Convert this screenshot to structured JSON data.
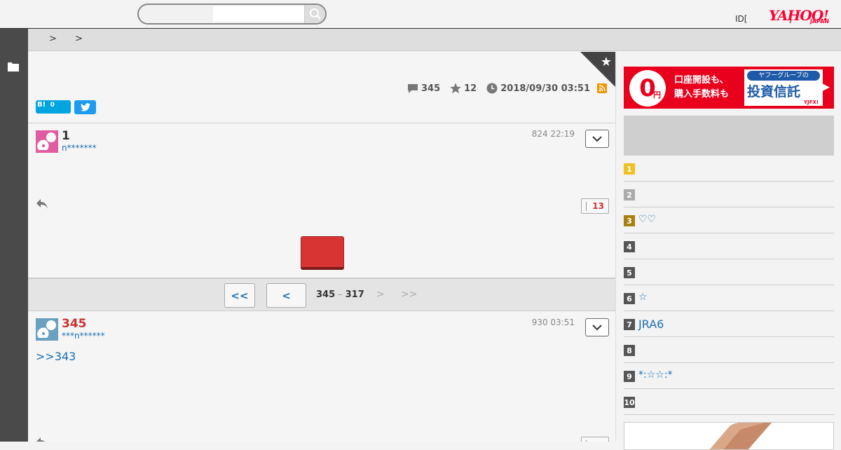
{
  "header": {
    "search_value": "",
    "id_link": "ID[",
    "id_bracket": "]",
    "logo_main": "YAHOO!",
    "logo_sub": "JAPAN"
  },
  "breadcrumb": {
    "sep1": ">",
    "sep2": ">"
  },
  "thread": {
    "comment_count": "345",
    "favorite_count": "12",
    "updated": "2018/09/30 03:51",
    "hatena_label": "B!",
    "hatena_count": "0"
  },
  "comments": [
    {
      "number": "1",
      "user": "n*******",
      "date": "824 22:19",
      "likes": "13"
    },
    {
      "number": "345",
      "user": "***n******",
      "date": "930 03:51",
      "body": ">>343"
    }
  ],
  "pager": {
    "first": "<<",
    "prev": "<",
    "range_start": "345",
    "range_dash": "–",
    "range_end": "317",
    "next": ">",
    "last": ">>"
  },
  "ad": {
    "zero": "0",
    "yen": "円",
    "line1": "口座開設も、",
    "line2": "購入手数料も",
    "rt_top": "ヤフーグループの",
    "rt_main": "投資信託",
    "rt_brand": "YJFX!"
  },
  "ranking": [
    {
      "rank": "1",
      "title": "",
      "color": "#f0c020"
    },
    {
      "rank": "2",
      "title": "",
      "color": "#aaaaaa"
    },
    {
      "rank": "3",
      "title": "♡♡",
      "color": "#a88010"
    },
    {
      "rank": "4",
      "title": "",
      "color": "#555555"
    },
    {
      "rank": "5",
      "title": "",
      "color": "#555555"
    },
    {
      "rank": "6",
      "title": "☆",
      "color": "#555555"
    },
    {
      "rank": "7",
      "title": "JRA6",
      "color": "#555555"
    },
    {
      "rank": "8",
      "title": "",
      "color": "#555555"
    },
    {
      "rank": "9",
      "title": "*:☆☆:*",
      "color": "#555555"
    },
    {
      "rank": "10",
      "title": "",
      "color": "#555555"
    }
  ]
}
